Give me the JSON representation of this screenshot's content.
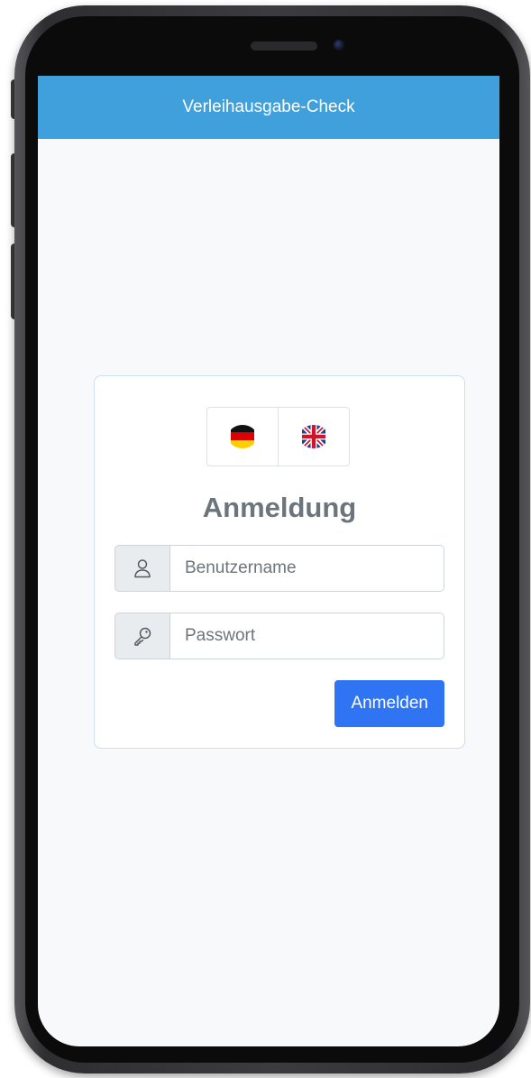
{
  "app": {
    "title": "Verleihausgabe-Check"
  },
  "login": {
    "heading": "Anmeldung",
    "languages": [
      {
        "code": "de",
        "icon": "flag-germany-icon"
      },
      {
        "code": "en",
        "icon": "flag-uk-icon"
      }
    ],
    "username": {
      "placeholder": "Benutzername",
      "value": "",
      "icon": "user-icon"
    },
    "password": {
      "placeholder": "Passwort",
      "value": "",
      "icon": "key-icon"
    },
    "submit_label": "Anmelden"
  },
  "colors": {
    "navbar": "#3fa0dc",
    "primary_button": "#2f74f2",
    "heading": "#6c757d",
    "background": "#f8f9fa"
  }
}
